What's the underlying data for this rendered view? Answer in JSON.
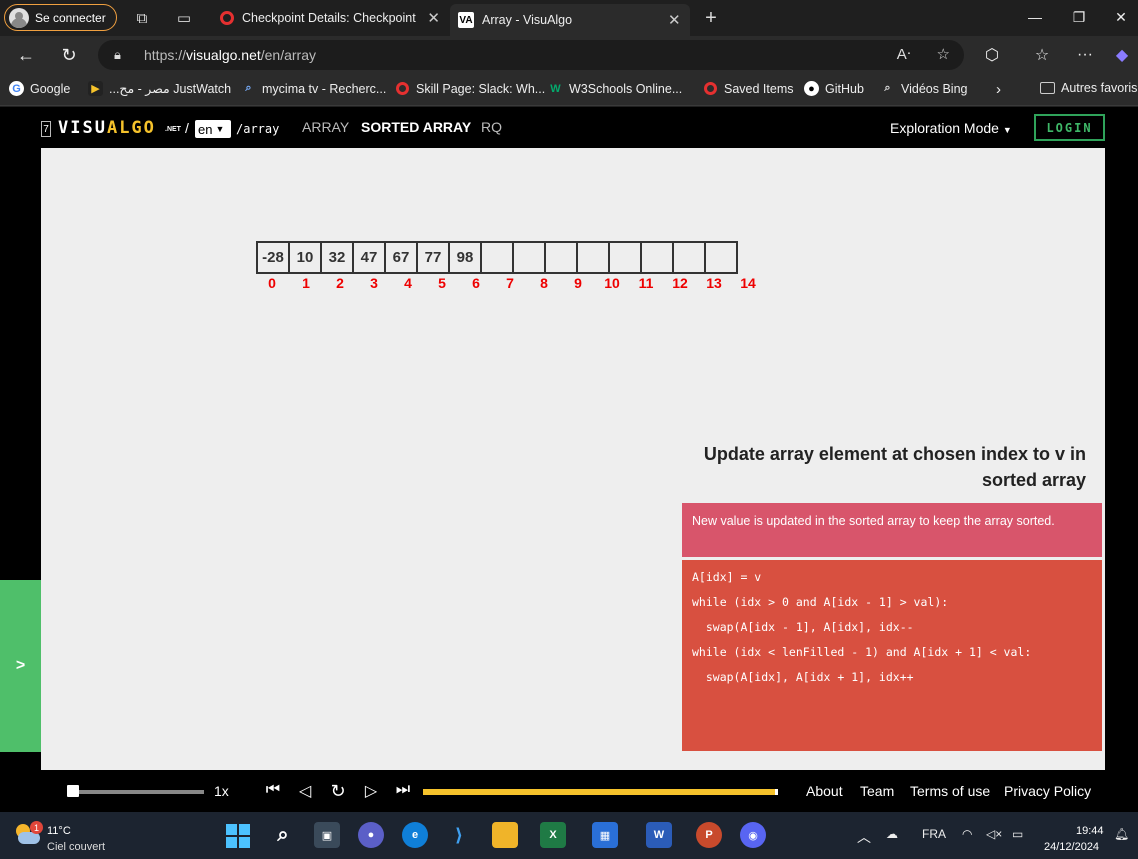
{
  "browser": {
    "profile_label": "Se connecter",
    "tabs": [
      {
        "title": "Checkpoint Details: Checkpoint D",
        "active": false
      },
      {
        "title": "Array - VisuAlgo",
        "active": true
      }
    ],
    "new_tab": "+",
    "url_prefix": "https://",
    "url_host": "visualgo.net",
    "url_path": "/en/array",
    "bookmarks": [
      {
        "label": "Google",
        "icon": "google-icon"
      },
      {
        "label": "...مصر - مح JustWatch",
        "icon": "justwatch-icon"
      },
      {
        "label": "mycima tv - Recherc...",
        "icon": "search-icon"
      },
      {
        "label": "Skill Page: Slack: Wh...",
        "icon": "opera-icon"
      },
      {
        "label": "W3Schools Online...",
        "icon": "w3schools-icon"
      },
      {
        "label": "Saved Items",
        "icon": "opera-icon"
      },
      {
        "label": "GitHub",
        "icon": "github-icon"
      },
      {
        "label": "Vidéos Bing",
        "icon": "search-icon"
      }
    ],
    "other_bookmarks": "Autres favoris"
  },
  "site": {
    "logo_box": "7",
    "logo_part1": "VISU",
    "logo_part2": "ALGO",
    "logo_net": ".NET",
    "logo_slash": "/",
    "lang": "en",
    "path": "/array",
    "nav": [
      {
        "label": "ARRAY",
        "active": false
      },
      {
        "label": "SORTED ARRAY",
        "active": true
      },
      {
        "label": "RQ",
        "active": false
      }
    ],
    "mode": "Exploration Mode",
    "login": "LOGIN"
  },
  "array": {
    "values": [
      "-28",
      "10",
      "32",
      "47",
      "67",
      "77",
      "98",
      "",
      "",
      "",
      "",
      "",
      "",
      "",
      ""
    ],
    "indices": [
      "0",
      "1",
      "2",
      "3",
      "4",
      "5",
      "6",
      "7",
      "8",
      "9",
      "10",
      "11",
      "12",
      "13",
      "14"
    ]
  },
  "status": {
    "title_line1": "Update array element at chosen index to v in",
    "title_line2": "sorted array",
    "message": "New value is updated in the sorted array to keep the array sorted."
  },
  "code": [
    "A[idx] = v",
    "while (idx > 0 and A[idx - 1] > val):",
    "  swap(A[idx - 1], A[idx], idx--",
    "while (idx < lenFilled - 1) and A[idx + 1] < val:",
    "  swap(A[idx], A[idx + 1], idx++"
  ],
  "controls": {
    "speed": "1x",
    "speed_fraction": 0.0,
    "progress_fraction": 1.0
  },
  "footer_links": [
    "About",
    "Team",
    "Terms of use",
    "Privacy Policy"
  ],
  "taskbar": {
    "weather_badge": "1",
    "temperature": "11°C",
    "sky": "Ciel couvert",
    "language": "FRA",
    "time": "19:44",
    "date": "24/12/2024"
  },
  "colors": {
    "accent_yellow": "#f5c22b",
    "status_pink": "#d8556b",
    "code_red": "#d85040",
    "side_green": "#4fbf6a",
    "index_red": "#ee0000"
  }
}
